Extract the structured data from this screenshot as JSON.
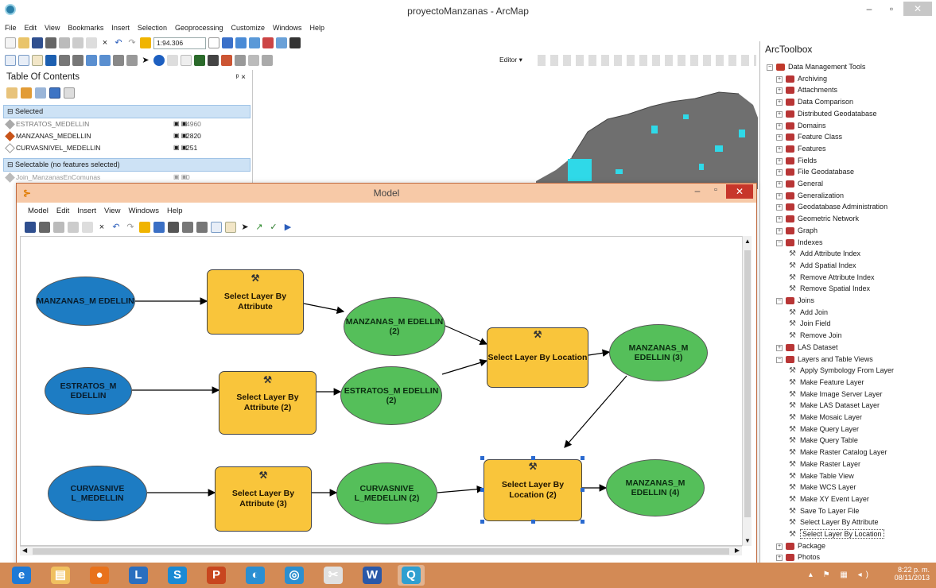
{
  "window": {
    "title": "proyectoManzanas - ArcMap",
    "min": "–",
    "max": "▫",
    "close": "✕"
  },
  "menubar": [
    "File",
    "Edit",
    "View",
    "Bookmarks",
    "Insert",
    "Selection",
    "Geoprocessing",
    "Customize",
    "Windows",
    "Help"
  ],
  "toolbar": {
    "scale_value": "1:94.306",
    "editor_label": "Editor ▾"
  },
  "toc": {
    "title": "Table Of Contents",
    "pin": "ᵖ ×",
    "groups": [
      {
        "label": "Selected",
        "layers": [
          {
            "name": "ESTRATOS_MEDELLIN",
            "count": "4960"
          },
          {
            "name": "MANZANAS_MEDELLIN",
            "count": "2820"
          },
          {
            "name": "CURVASNIVEL_MEDELLIN",
            "count": "251"
          }
        ]
      },
      {
        "label": "Selectable (no features selected)",
        "layers": [
          {
            "name": "Join_ManzanasEnComunas",
            "count": "0"
          }
        ]
      }
    ]
  },
  "model": {
    "title": "Model",
    "menu": [
      "Model",
      "Edit",
      "Insert",
      "View",
      "Windows",
      "Help"
    ],
    "nodes": {
      "in1": "MANZANAS_M EDELLIN",
      "in2": "ESTRATOS_M EDELLIN",
      "in3": "CURVASNIVE L_MEDELLIN",
      "t1": "Select Layer By Attribute",
      "t2": "Select Layer By Attribute (2)",
      "t3": "Select Layer By Attribute (3)",
      "o1": "MANZANAS_M EDELLIN (2)",
      "o2": "ESTRATOS_M EDELLIN (2)",
      "o3": "CURVASNIVE L_MEDELLIN (2)",
      "loc1": "Select Layer By Location",
      "loc2": "Select Layer By Location (2)",
      "r1": "MANZANAS_M EDELLIN (3)",
      "r2": "MANZANAS_M EDELLIN (4)"
    }
  },
  "arctoolbox": {
    "title": "ArcToolbox",
    "items": [
      {
        "label": "Data Management Tools",
        "level": 0,
        "kind": "box",
        "exp": "−"
      },
      {
        "label": "Archiving",
        "level": 1,
        "kind": "box",
        "exp": "+"
      },
      {
        "label": "Attachments",
        "level": 1,
        "kind": "box",
        "exp": "+"
      },
      {
        "label": "Data Comparison",
        "level": 1,
        "kind": "box",
        "exp": "+"
      },
      {
        "label": "Distributed Geodatabase",
        "level": 1,
        "kind": "box",
        "exp": "+"
      },
      {
        "label": "Domains",
        "level": 1,
        "kind": "box",
        "exp": "+"
      },
      {
        "label": "Feature Class",
        "level": 1,
        "kind": "box",
        "exp": "+"
      },
      {
        "label": "Features",
        "level": 1,
        "kind": "box",
        "exp": "+"
      },
      {
        "label": "Fields",
        "level": 1,
        "kind": "box",
        "exp": "+"
      },
      {
        "label": "File Geodatabase",
        "level": 1,
        "kind": "box",
        "exp": "+"
      },
      {
        "label": "General",
        "level": 1,
        "kind": "box",
        "exp": "+"
      },
      {
        "label": "Generalization",
        "level": 1,
        "kind": "box",
        "exp": "+"
      },
      {
        "label": "Geodatabase Administration",
        "level": 1,
        "kind": "box",
        "exp": "+"
      },
      {
        "label": "Geometric Network",
        "level": 1,
        "kind": "box",
        "exp": "+"
      },
      {
        "label": "Graph",
        "level": 1,
        "kind": "box",
        "exp": "+"
      },
      {
        "label": "Indexes",
        "level": 1,
        "kind": "box",
        "exp": "−"
      },
      {
        "label": "Add Attribute Index",
        "level": 2,
        "kind": "tool"
      },
      {
        "label": "Add Spatial Index",
        "level": 2,
        "kind": "tool"
      },
      {
        "label": "Remove Attribute Index",
        "level": 2,
        "kind": "tool"
      },
      {
        "label": "Remove Spatial Index",
        "level": 2,
        "kind": "tool"
      },
      {
        "label": "Joins",
        "level": 1,
        "kind": "box",
        "exp": "−"
      },
      {
        "label": "Add Join",
        "level": 2,
        "kind": "tool"
      },
      {
        "label": "Join Field",
        "level": 2,
        "kind": "tool"
      },
      {
        "label": "Remove Join",
        "level": 2,
        "kind": "tool"
      },
      {
        "label": "LAS Dataset",
        "level": 1,
        "kind": "box",
        "exp": "+"
      },
      {
        "label": "Layers and Table Views",
        "level": 1,
        "kind": "box",
        "exp": "−"
      },
      {
        "label": "Apply Symbology From Layer",
        "level": 2,
        "kind": "tool"
      },
      {
        "label": "Make Feature Layer",
        "level": 2,
        "kind": "tool"
      },
      {
        "label": "Make Image Server Layer",
        "level": 2,
        "kind": "tool"
      },
      {
        "label": "Make LAS Dataset Layer",
        "level": 2,
        "kind": "tool"
      },
      {
        "label": "Make Mosaic Layer",
        "level": 2,
        "kind": "tool"
      },
      {
        "label": "Make Query Layer",
        "level": 2,
        "kind": "tool"
      },
      {
        "label": "Make Query Table",
        "level": 2,
        "kind": "tool"
      },
      {
        "label": "Make Raster Catalog Layer",
        "level": 2,
        "kind": "tool"
      },
      {
        "label": "Make Raster Layer",
        "level": 2,
        "kind": "tool"
      },
      {
        "label": "Make Table View",
        "level": 2,
        "kind": "tool"
      },
      {
        "label": "Make WCS Layer",
        "level": 2,
        "kind": "tool"
      },
      {
        "label": "Make XY Event Layer",
        "level": 2,
        "kind": "tool"
      },
      {
        "label": "Save To Layer File",
        "level": 2,
        "kind": "tool"
      },
      {
        "label": "Select Layer By Attribute",
        "level": 2,
        "kind": "tool"
      },
      {
        "label": "Select Layer By Location",
        "level": 2,
        "kind": "tool",
        "highlight": true
      },
      {
        "label": "Package",
        "level": 1,
        "kind": "box",
        "exp": "+"
      },
      {
        "label": "Photos",
        "level": 1,
        "kind": "box",
        "exp": "+"
      }
    ]
  },
  "taskbar": {
    "apps": [
      {
        "icon": "internet-explorer-icon",
        "glyph": "e"
      },
      {
        "icon": "file-explorer-icon",
        "glyph": "▤"
      },
      {
        "icon": "firefox-icon",
        "glyph": "●"
      },
      {
        "icon": "arccatalog-icon",
        "glyph": "L"
      },
      {
        "icon": "skype-icon",
        "glyph": "S"
      },
      {
        "icon": "powerpoint-icon",
        "glyph": "P"
      },
      {
        "icon": "media-player-icon",
        "glyph": "◐"
      },
      {
        "icon": "chrome-icon",
        "glyph": "◎"
      },
      {
        "icon": "snipping-tool-icon",
        "glyph": "✂"
      },
      {
        "icon": "word-icon",
        "glyph": "W"
      },
      {
        "icon": "arcmap-icon",
        "glyph": "Q"
      }
    ],
    "time": "8:22 p. m.",
    "date": "08/11/2013"
  }
}
